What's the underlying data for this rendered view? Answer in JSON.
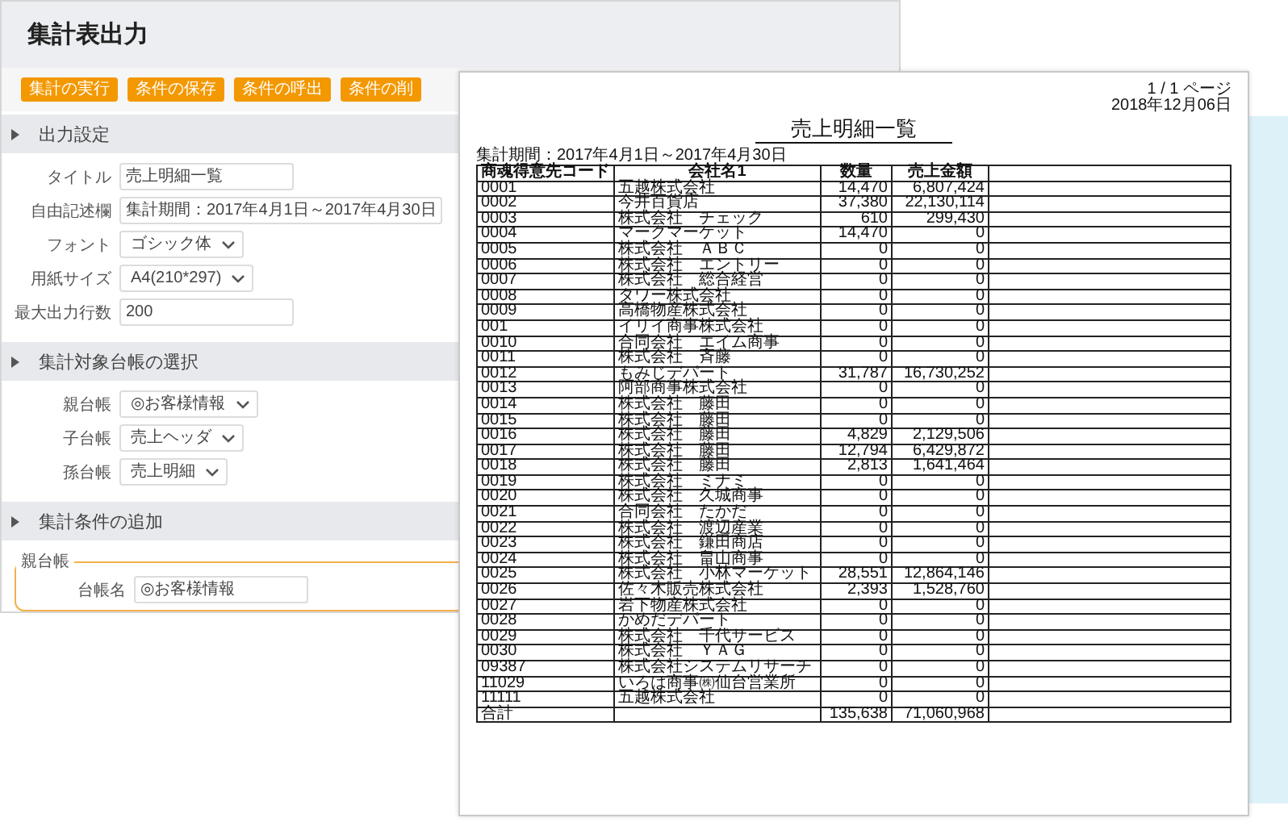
{
  "app": {
    "title": "集計表出力"
  },
  "toolbar": {
    "buttons": [
      "集計の実行",
      "条件の保存",
      "条件の呼出",
      "条件の削"
    ]
  },
  "sections": [
    {
      "title": "出力設定",
      "fields": [
        {
          "kind": "text",
          "label": "タイトル",
          "value": "売上明細一覧"
        },
        {
          "kind": "text",
          "label": "自由記述欄",
          "value": "集計期間：2017年4月1日～2017年4月30日"
        },
        {
          "kind": "select",
          "label": "フォント",
          "value": "ゴシック体"
        },
        {
          "kind": "select",
          "label": "用紙サイズ",
          "value": "A4(210*297)"
        },
        {
          "kind": "text",
          "label": "最大出力行数",
          "value": "200"
        }
      ]
    },
    {
      "title": "集計対象台帳の選択",
      "fields": [
        {
          "kind": "select",
          "label": "親台帳",
          "value": "◎お客様情報"
        },
        {
          "kind": "select",
          "label": "子台帳",
          "value": "売上ヘッダ"
        },
        {
          "kind": "select",
          "label": "孫台帳",
          "value": "売上明細"
        }
      ]
    },
    {
      "title": "集計条件の追加",
      "group": {
        "legend": "親台帳",
        "fields": [
          {
            "kind": "text",
            "label": "台帳名",
            "value": "◎お客様情報"
          }
        ]
      }
    }
  ],
  "report": {
    "page": "1 / 1 ページ",
    "date": "2018年12月06日",
    "title": "売上明細一覧",
    "period": "集計期間：2017年4月1日～2017年4月30日",
    "columns": [
      "商魂得意先コード",
      "会社名1",
      "数量",
      "売上金額"
    ],
    "rows": [
      [
        "0001",
        "五越株式会社",
        "14,470",
        "6,807,424"
      ],
      [
        "0002",
        "今井百貨店",
        "37,380",
        "22,130,114"
      ],
      [
        "0003",
        "株式会社　チェック",
        "610",
        "299,430"
      ],
      [
        "0004",
        "マークマーケット",
        "14,470",
        "0"
      ],
      [
        "0005",
        "株式会社　ＡＢＣ",
        "0",
        "0"
      ],
      [
        "0006",
        "株式会社　エントリー",
        "0",
        "0"
      ],
      [
        "0007",
        "株式会社　総合経営",
        "0",
        "0"
      ],
      [
        "0008",
        "タワー株式会社",
        "0",
        "0"
      ],
      [
        "0009",
        "高橋物産株式会社",
        "0",
        "0"
      ],
      [
        "001",
        "イリイ商事株式会社",
        "0",
        "0"
      ],
      [
        "0010",
        "合同会社　エイム商事",
        "0",
        "0"
      ],
      [
        "0011",
        "株式会社　斉藤",
        "0",
        "0"
      ],
      [
        "0012",
        "もみじデパート",
        "31,787",
        "16,730,252"
      ],
      [
        "0013",
        "阿部商事株式会社",
        "0",
        "0"
      ],
      [
        "0014",
        "株式会社　藤田",
        "0",
        "0"
      ],
      [
        "0015",
        "株式会社　藤田",
        "0",
        "0"
      ],
      [
        "0016",
        "株式会社　藤田",
        "4,829",
        "2,129,506"
      ],
      [
        "0017",
        "株式会社　藤田",
        "12,794",
        "6,429,872"
      ],
      [
        "0018",
        "株式会社　藤田",
        "2,813",
        "1,641,464"
      ],
      [
        "0019",
        "株式会社　ミナミ",
        "0",
        "0"
      ],
      [
        "0020",
        "株式会社　久城商事",
        "0",
        "0"
      ],
      [
        "0021",
        "合同会社　たかだ",
        "0",
        "0"
      ],
      [
        "0022",
        "株式会社　渡辺産業",
        "0",
        "0"
      ],
      [
        "0023",
        "株式会社　鎌田商店",
        "0",
        "0"
      ],
      [
        "0024",
        "株式会社　畠山商事",
        "0",
        "0"
      ],
      [
        "0025",
        "株式会社　小林マーケット",
        "28,551",
        "12,864,146"
      ],
      [
        "0026",
        "佐々木販売株式会社",
        "2,393",
        "1,528,760"
      ],
      [
        "0027",
        "岩下物産株式会社",
        "0",
        "0"
      ],
      [
        "0028",
        "かめだデパート",
        "0",
        "0"
      ],
      [
        "0029",
        "株式会社　千代サービス",
        "0",
        "0"
      ],
      [
        "0030",
        "株式会社　ＹＡＧ",
        "0",
        "0"
      ],
      [
        "09387",
        "株式会社システムリサーチ",
        "0",
        "0"
      ],
      [
        "11029",
        "いろは商事㈱仙台営業所",
        "0",
        "0"
      ],
      [
        "11111",
        "五越株式会社",
        "0",
        "0"
      ]
    ],
    "total": {
      "label": "合計",
      "quantity": "135,638",
      "amount": "71,060,968"
    }
  }
}
